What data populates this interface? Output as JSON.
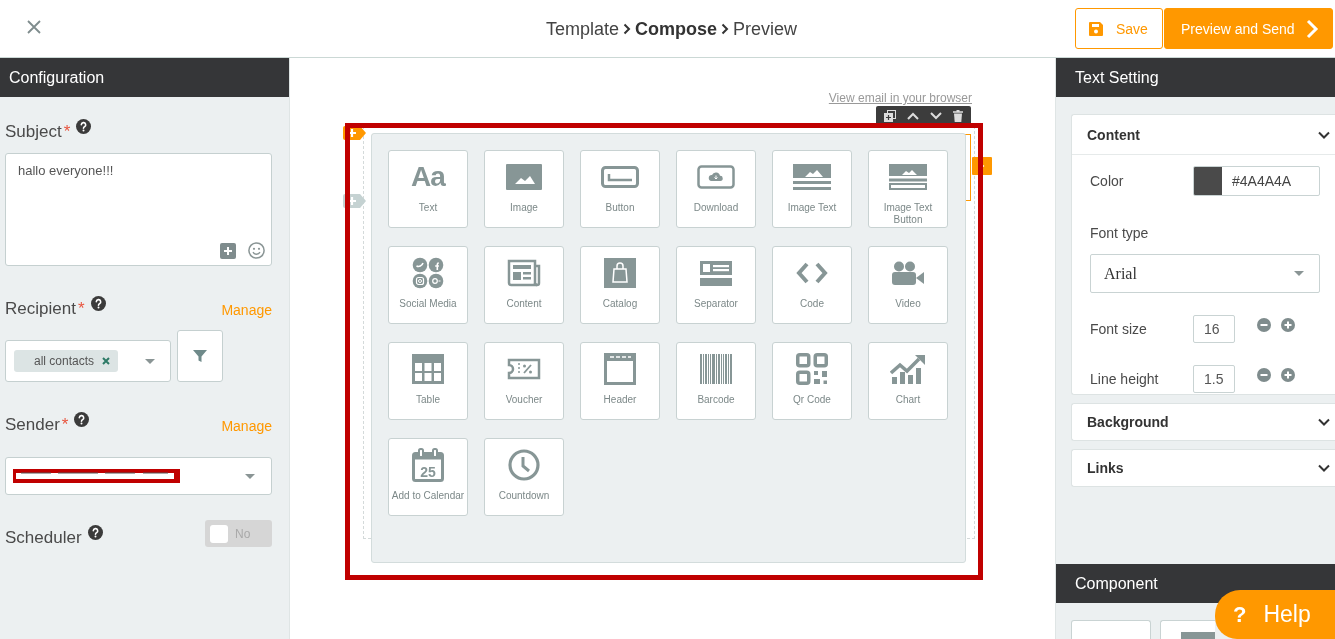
{
  "top_bar": {
    "steps": [
      {
        "label": "Template",
        "selected": false
      },
      {
        "label": "Compose",
        "selected": true
      },
      {
        "label": "Preview",
        "selected": false
      }
    ],
    "save_button": "Save",
    "send_button": "Preview and Send"
  },
  "configuration": {
    "title": "Configuration",
    "subject": {
      "label": "Subject",
      "required_mark": "*",
      "value": "hallo everyone!!!"
    },
    "recipient": {
      "label": "Recipient",
      "required_mark": "*",
      "manage_link": "Manage",
      "chips": [
        "all contacts"
      ]
    },
    "sender": {
      "label": "Sender",
      "required_mark": "*",
      "manage_link": "Manage"
    },
    "scheduler": {
      "label": "Scheduler",
      "on": false,
      "state_label": "No"
    }
  },
  "email": {
    "browser_link": "View email in your browser"
  },
  "component_picker": {
    "items": [
      {
        "kind": "text",
        "glyph": "Aa",
        "label": "Text"
      },
      {
        "kind": "image",
        "label": "Image"
      },
      {
        "kind": "button",
        "label": "Button"
      },
      {
        "kind": "download",
        "label": "Download"
      },
      {
        "kind": "image_text",
        "label": "Image Text"
      },
      {
        "kind": "image_text_button",
        "label": "Image Text Button"
      },
      {
        "kind": "social_media",
        "label": "Social Media"
      },
      {
        "kind": "content",
        "label": "Content"
      },
      {
        "kind": "catalog",
        "label": "Catalog"
      },
      {
        "kind": "separator",
        "label": "Separator"
      },
      {
        "kind": "code",
        "label": "Code"
      },
      {
        "kind": "video",
        "label": "Video"
      },
      {
        "kind": "table",
        "label": "Table"
      },
      {
        "kind": "voucher",
        "label": "Voucher"
      },
      {
        "kind": "header",
        "label": "Header"
      },
      {
        "kind": "barcode",
        "label": "Barcode"
      },
      {
        "kind": "qr_code",
        "label": "Qr Code"
      },
      {
        "kind": "chart",
        "label": "Chart"
      },
      {
        "kind": "calendar",
        "glyph": "25",
        "label": "Add to Calendar"
      },
      {
        "kind": "countdown",
        "label": "Countdown"
      }
    ]
  },
  "text_setting": {
    "title": "Text Setting",
    "sections": [
      {
        "title": "Content",
        "expanded": true,
        "fields": [
          {
            "kind": "color",
            "label": "Color",
            "value": "#4A4A4A"
          },
          {
            "kind": "select",
            "label": "Font type",
            "value": "Arial"
          },
          {
            "kind": "number",
            "label": "Font size",
            "value": "16"
          },
          {
            "kind": "number",
            "label": "Line height",
            "value": "1.5"
          }
        ]
      },
      {
        "title": "Background",
        "expanded": false
      },
      {
        "title": "Links",
        "expanded": false
      }
    ]
  },
  "component_panel": {
    "title": "Component"
  },
  "help_button": {
    "glyph": "?",
    "label": "Help"
  }
}
